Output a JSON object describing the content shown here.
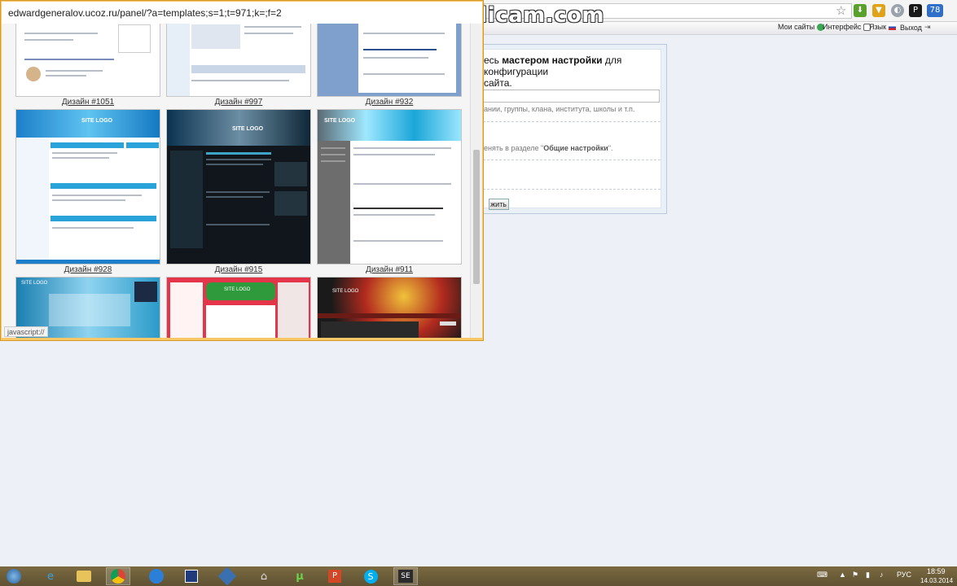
{
  "watermark": "www.Bandicam.com",
  "popup": {
    "url": "edwardgeneralov.ucoz.ru/panel/?a=templates;s=1;t=971;k=;f=2",
    "status": "javascript://",
    "designs": [
      {
        "caption": "Дизайн #1051"
      },
      {
        "caption": "Дизайн #997"
      },
      {
        "caption": "Дизайн #932"
      },
      {
        "caption": "Дизайн #928",
        "logo": "SITE LOGO"
      },
      {
        "caption": "Дизайн #915",
        "logo": "SITE LOGO"
      },
      {
        "caption": "Дизайн #911",
        "logo": "SITE LOGO"
      },
      {
        "caption": "",
        "logo": "SITE LOGO"
      },
      {
        "caption": "",
        "logo": "SITE LOGO"
      },
      {
        "caption": "",
        "logo": "SITE LOGO"
      }
    ]
  },
  "ucoz_menu": {
    "my_sites": "Мои сайты",
    "interface": "Интерфейс",
    "language": "Язык",
    "logout": "Выход"
  },
  "panel": {
    "line1_prefix": "есь ",
    "line1_bold": "мастером настройки",
    "line1_suffix": " для конфигурации",
    "line2": "сайта.",
    "hint": "ании, группы, клана, института, школы и т.п.",
    "note_prefix": "енять в разделе \"",
    "note_bold": "Общие настройки",
    "note_suffix": "\".",
    "button": "жить"
  },
  "extensions": {
    "badge": "78"
  },
  "taskbar": {
    "language": "РУС",
    "time": "18:59",
    "date": "14.03.2014"
  },
  "colors": {
    "popup_border": "#f9c866",
    "taskbar": "#6b5c3a",
    "page_bg": "#eef0f7"
  }
}
